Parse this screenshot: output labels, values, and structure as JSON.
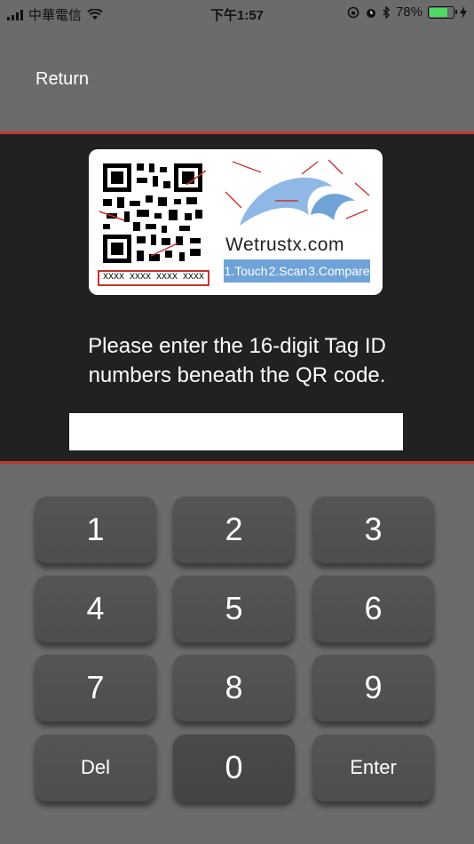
{
  "status_bar": {
    "carrier": "中華電信",
    "time": "下午1:57",
    "battery_percent": "78%",
    "battery_level": 0.78,
    "icons": [
      "signal-icon",
      "wifi-icon",
      "rotation-lock-icon",
      "alarm-icon",
      "bluetooth-icon",
      "battery-icon",
      "charging-icon"
    ]
  },
  "nav": {
    "return_label": "Return"
  },
  "card": {
    "tag_digits": "XXXX XXXX XXXX XXXX",
    "brand": "Wetrustx.com",
    "steps": [
      "1.Touch",
      "2.Scan",
      "3.Compare"
    ]
  },
  "prompt": {
    "line1": "Please enter the 16-digit Tag ID",
    "line2": "numbers beneath the QR code."
  },
  "input": {
    "value": "",
    "placeholder": ""
  },
  "keypad": {
    "k1": "1",
    "k2": "2",
    "k3": "3",
    "k4": "4",
    "k5": "5",
    "k6": "6",
    "k7": "7",
    "k8": "8",
    "k9": "9",
    "del": "Del",
    "k0": "0",
    "enter": "Enter"
  },
  "colors": {
    "accent_red": "#c5362e",
    "panel": "#212121",
    "background": "#6b6b6b",
    "key": "#515151",
    "brand_blue": "#6fa3d8"
  }
}
